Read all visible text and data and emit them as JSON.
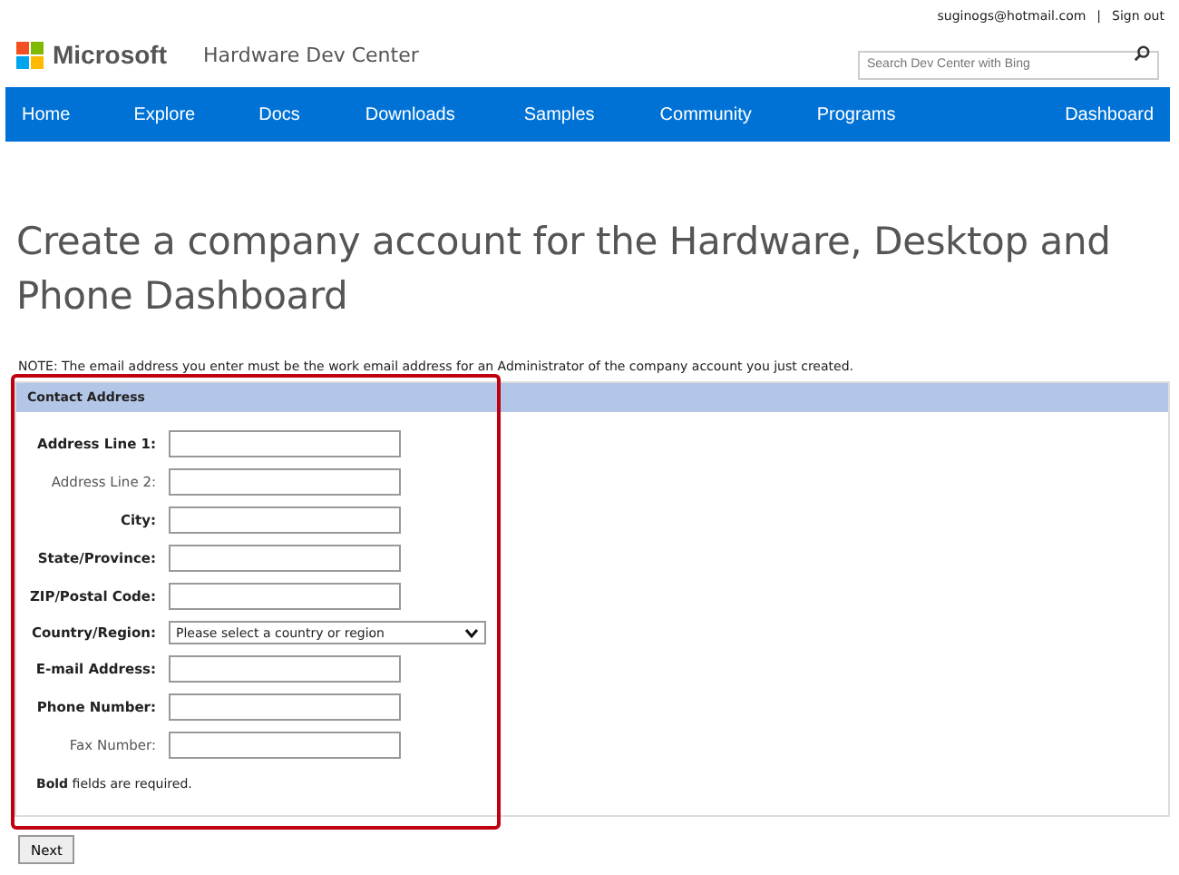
{
  "account": {
    "email": "suginogs@hotmail.com",
    "separator": "|",
    "sign_out": "Sign out"
  },
  "brand": {
    "logo_text": "Microsoft",
    "site_title": "Hardware Dev Center"
  },
  "search": {
    "placeholder": "Search Dev Center with Bing"
  },
  "nav": {
    "items": [
      {
        "label": "Home"
      },
      {
        "label": "Explore"
      },
      {
        "label": "Docs"
      },
      {
        "label": "Downloads"
      },
      {
        "label": "Samples"
      },
      {
        "label": "Community"
      },
      {
        "label": "Programs"
      }
    ],
    "right_item": {
      "label": "Dashboard"
    }
  },
  "heading": "Create a company account for the Hardware, Desktop and Phone Dashboard",
  "note": "NOTE: The email address you enter must be the work email address for an Administrator of the company account you just created.",
  "form": {
    "title": "Contact Address",
    "highlighted": true,
    "fields": [
      {
        "label": "Address Line 1:",
        "kind": "text",
        "required": true
      },
      {
        "label": "Address Line 2:",
        "kind": "text",
        "required": false
      },
      {
        "label": "City:",
        "kind": "text",
        "required": true
      },
      {
        "label": "State/Province:",
        "kind": "text",
        "required": true
      },
      {
        "label": "ZIP/Postal Code:",
        "kind": "text",
        "required": true
      },
      {
        "label": "Country/Region:",
        "kind": "select",
        "required": true,
        "value": "Please select a country or region"
      },
      {
        "label": "E-mail Address:",
        "kind": "text",
        "required": true
      },
      {
        "label": "Phone Number:",
        "kind": "text",
        "required": true
      },
      {
        "label": "Fax Number:",
        "kind": "text",
        "required": false
      }
    ],
    "footnote": "**Bold** fields are required."
  },
  "buttons": [
    "Next"
  ]
}
